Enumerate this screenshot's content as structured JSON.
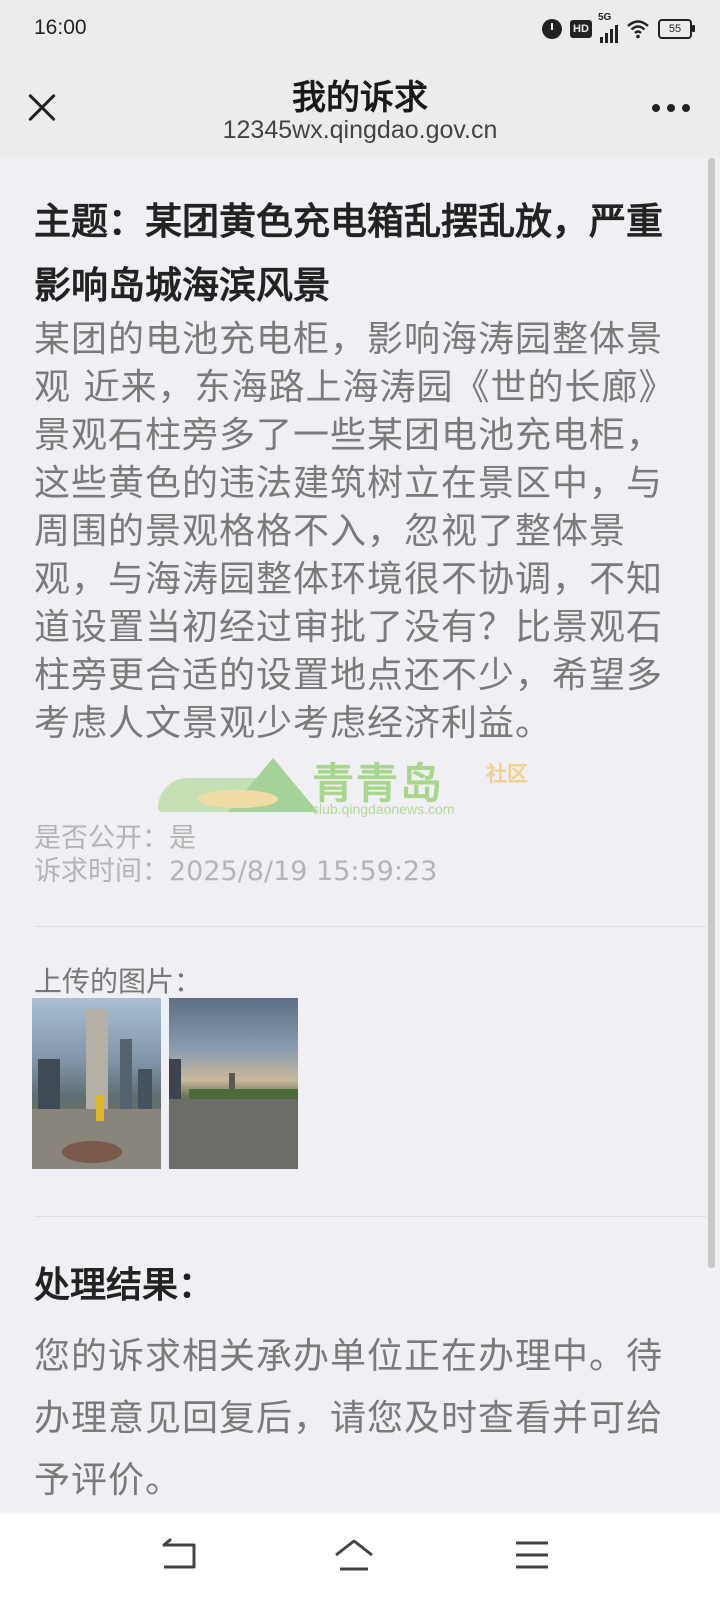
{
  "status_bar": {
    "time": "16:00",
    "hd_label": "HD",
    "network_label": "5G",
    "battery_level": "55",
    "icons": [
      "alarm-icon",
      "hd-icon",
      "signal-5g-icon",
      "wifi-icon",
      "battery-icon"
    ]
  },
  "header": {
    "title": "我的诉求",
    "url": "12345wx.qingdao.gov.cn",
    "close_icon": "close-icon",
    "more_icon": "more-icon"
  },
  "complaint": {
    "subject": "主题：某团黄色充电箱乱摆乱放，严重影响岛城海滨风景",
    "description": "某团的电池充电柜，影响海涛园整体景观 近来，东海路上海涛园《世的长廊》景观石柱旁多了一些某团电池充电柜，这些黄色的违法建筑树立在景区中，与周围的景观格格不入，忽视了整体景观，与海涛园整体环境很不协调，不知道设置当初经过审批了没有？比景观石柱旁更合适的设置地点还不少，希望多考虑人文景观少考虑经济利益。",
    "is_public": "是否公开：是",
    "time": "诉求时间：2025/8/19 15:59:23"
  },
  "watermark": {
    "brand": "青青岛",
    "club": "社区",
    "url": "club.qingdaonews.com"
  },
  "uploads": {
    "label": "上传的图片："
  },
  "result": {
    "title": "处理结果：",
    "text": "您的诉求相关承办单位正在办理中。待办理意见回复后，请您及时查看并可给予评价。"
  },
  "nav": {
    "icons": [
      "back-icon",
      "home-icon",
      "menu-icon"
    ]
  },
  "colors": {
    "background": "#f0eff4",
    "header": "#ececec",
    "muted_text": "#7a7a7a",
    "watermark_green": "#8fcf6b"
  }
}
